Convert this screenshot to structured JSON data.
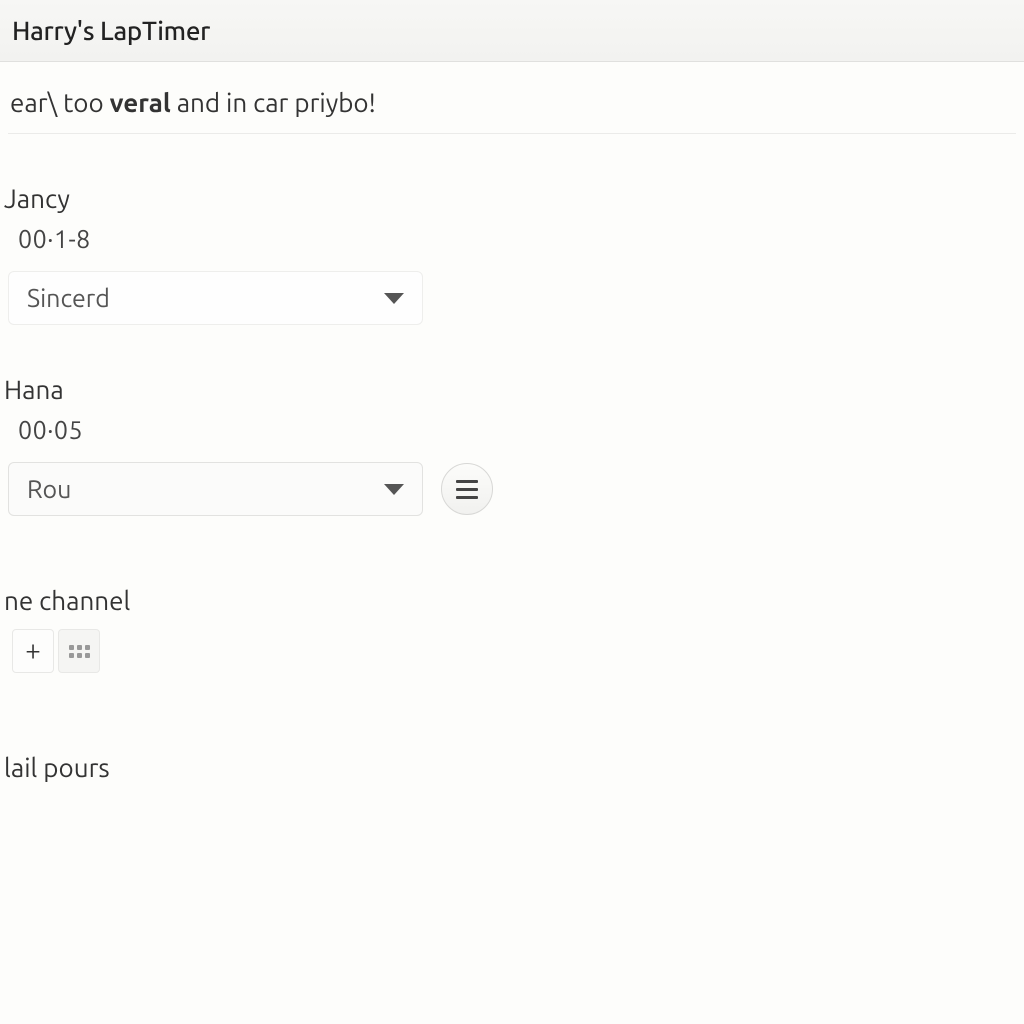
{
  "header": {
    "title": "Harry's LapTimer"
  },
  "intro": {
    "part1": "ear\\ too ",
    "bold": "veral",
    "part2": " and in car priybo!"
  },
  "sections": [
    {
      "label": "Jancy",
      "value": "00·1-8",
      "dropdown": "Sincerd"
    },
    {
      "label": "Hana",
      "value": "00·05",
      "dropdown": "Rou"
    }
  ],
  "channel": {
    "label": "ne channel"
  },
  "bottom": {
    "label": "lail pours"
  }
}
